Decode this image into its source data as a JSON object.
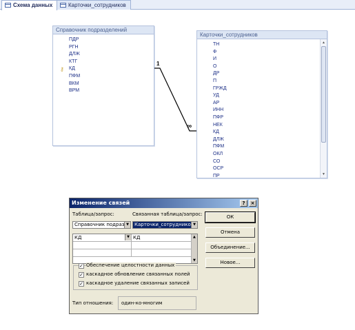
{
  "tabs": [
    {
      "label": "Схема данных",
      "active": true
    },
    {
      "label": "Карточки_сотрудников",
      "active": false
    }
  ],
  "table_left": {
    "title": "Справочник подразделений",
    "fields": [
      "ПДР",
      "РГН",
      "ДЛЖ",
      "КТГ",
      "КД",
      "ПФМ",
      "ВКМ",
      "ВРМ"
    ],
    "key_field": "КД"
  },
  "table_right": {
    "title": "Карточки_сотрудников",
    "fields": [
      "ТН",
      "Ф",
      "И",
      "О",
      "ДР",
      "П",
      "ГРЖД",
      "УД",
      "АР",
      "ИНН",
      "ПФР",
      "НЕК",
      "КД",
      "ДЛЖ",
      "ПФМ",
      "ОКЛ",
      "СО",
      "ОСР",
      "ПР"
    ]
  },
  "relation": {
    "one_label": "1",
    "many_label": "∞"
  },
  "dialog": {
    "title": "Изменение связей",
    "help_label": "?",
    "close_label": "×",
    "table_label": "Таблица/запрос:",
    "related_label": "Связанная таблица/запрос:",
    "table_value": "Справочник подразд",
    "related_value": "Карточки_сотрудников",
    "field_left": "КД",
    "field_right": "КД",
    "buttons": {
      "ok": "ОК",
      "cancel": "Отмена",
      "join": "Объединение...",
      "new": "Новое..."
    },
    "checkboxes": [
      {
        "label": "Обеспечение целостности данных",
        "checked": true
      },
      {
        "label": "каскадное обновление связанных полей",
        "checked": true
      },
      {
        "label": "каскадное удаление связанных записей",
        "checked": true
      }
    ],
    "relationship_type_label": "Тип отношения:",
    "relationship_type_value": "один-ко-многим"
  }
}
